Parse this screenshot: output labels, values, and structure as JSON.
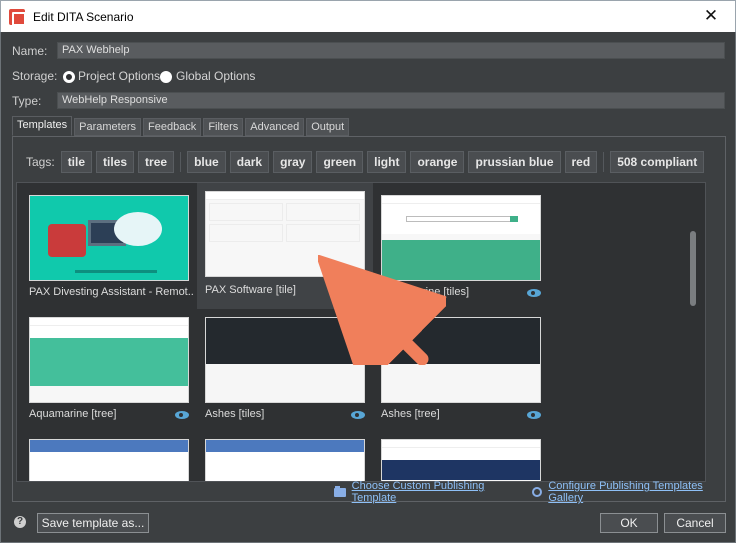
{
  "window": {
    "title": "Edit DITA Scenario"
  },
  "form": {
    "name_label": "Name:",
    "name_value": "PAX Webhelp",
    "storage_label": "Storage:",
    "storage_options": [
      "Project Options",
      "Global Options"
    ],
    "type_label": "Type:",
    "type_value": "WebHelp Responsive"
  },
  "tabs": [
    "Templates",
    "Parameters",
    "Feedback",
    "Filters",
    "Advanced",
    "Output"
  ],
  "tags": {
    "label": "Tags:",
    "items": [
      "tile",
      "tiles",
      "tree",
      "blue",
      "dark",
      "gray",
      "green",
      "light",
      "orange",
      "prussian blue",
      "red",
      "508 compliant"
    ]
  },
  "templates": [
    {
      "name": "PAX Divesting Assistant - Remot...",
      "eye": false
    },
    {
      "name": "PAX Software [tile]",
      "eye": false
    },
    {
      "name": "Aquamarine [tiles]",
      "eye": true
    },
    {
      "name": "Aquamarine [tree]",
      "eye": true
    },
    {
      "name": "Ashes [tiles]",
      "eye": true
    },
    {
      "name": "Ashes [tree]",
      "eye": true
    }
  ],
  "links": {
    "custom": "Choose Custom Publishing Template",
    "configure": "Configure Publishing Templates Gallery"
  },
  "buttons": {
    "save": "Save template as...",
    "ok": "OK",
    "cancel": "Cancel"
  },
  "colors": {
    "accent": "#4c79be",
    "arrow": "#f07f5b",
    "eye": "#58a6d6"
  }
}
